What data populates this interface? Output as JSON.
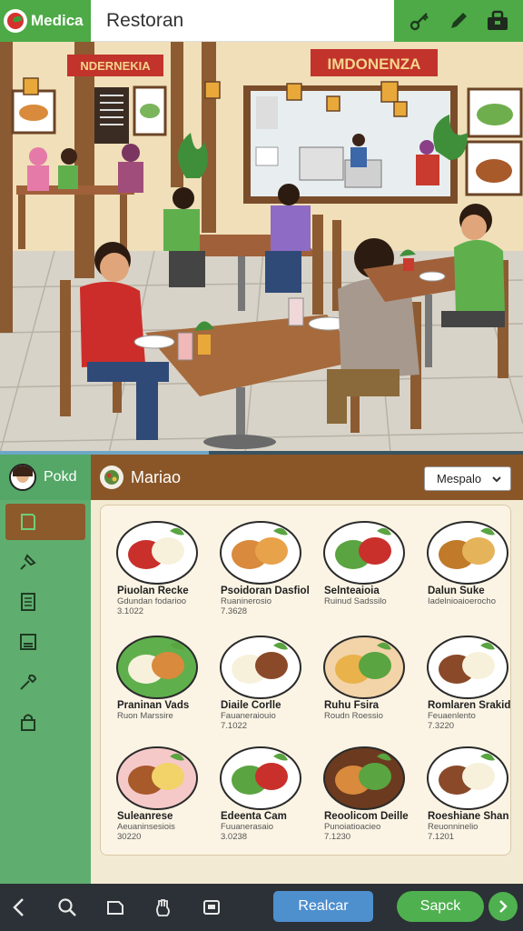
{
  "app": {
    "name": "Medica"
  },
  "search": {
    "value": "Restoran"
  },
  "toolbar": {
    "icons": [
      "key-icon",
      "pen-icon",
      "toolbox-icon"
    ]
  },
  "scene": {
    "signs": [
      "NDERNEKIA",
      "IMDONENZA"
    ],
    "progress_fraction": 0.4
  },
  "sidebar": {
    "profile_name": "Pokd",
    "items": [
      "book-icon",
      "pin-icon",
      "document-icon",
      "archive-icon",
      "wrench-icon",
      "lock-icon"
    ]
  },
  "content": {
    "title": "Mariao",
    "dropdown": "Mespalo"
  },
  "menu": [
    {
      "name": "Piuolan Recke",
      "desc": "Gdundan fodarioo",
      "price": "3.1022"
    },
    {
      "name": "Psoidoran Dasfiol",
      "desc": "Ruaninerosio",
      "price": "7.3628"
    },
    {
      "name": "Selnteaioia",
      "desc": "Ruinud Sadssilo",
      "price": ""
    },
    {
      "name": "Dalun Suke",
      "desc": "Iadelnioaioerocho",
      "price": ""
    },
    {
      "name": "Praninan Vads",
      "desc": "Ruon Marssire",
      "price": ""
    },
    {
      "name": "Diaile Corlle",
      "desc": "Fauaneraiouio",
      "price": "7.1022"
    },
    {
      "name": "Ruhu Fsira",
      "desc": "Roudn Roessio",
      "price": ""
    },
    {
      "name": "Romlaren Srakid",
      "desc": "Feuaenlento",
      "price": "7.3220"
    },
    {
      "name": "Suleanrese",
      "desc": "Aeuaninsesiois",
      "price": "30220"
    },
    {
      "name": "Edeenta Cam",
      "desc": "Fuuanerasaio",
      "price": "3.0238"
    },
    {
      "name": "Reoolicom Deille",
      "desc": "Punoiatioacieo",
      "price": "7.1230"
    },
    {
      "name": "Roeshiane Shan",
      "desc": "Reuonninelio",
      "price": "7.1201"
    }
  ],
  "bottom": {
    "icons": [
      "back-icon",
      "search-icon",
      "tag-icon",
      "hand-icon",
      "card-icon"
    ],
    "primary": "Realcar",
    "secondary": "Sapck"
  }
}
